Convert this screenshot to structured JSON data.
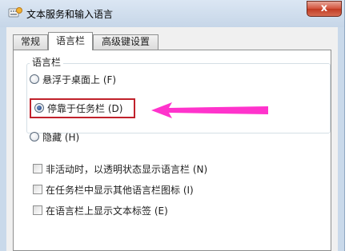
{
  "window": {
    "title": "文本服务和输入语言",
    "close_symbol": "x"
  },
  "tabs": [
    {
      "label": "常规",
      "active": false
    },
    {
      "label": "语言栏",
      "active": true
    },
    {
      "label": "高级键设置",
      "active": false
    }
  ],
  "language_bar_group": {
    "title": "语言栏",
    "options": [
      {
        "label": "悬浮于桌面上 (F)",
        "checked": false
      },
      {
        "label": "停靠于任务栏 (D)",
        "checked": true
      },
      {
        "label": "隐藏 (H)",
        "checked": false
      }
    ]
  },
  "checkboxes": [
    {
      "label": "非活动时，以透明状态显示语言栏 (N)",
      "checked": false
    },
    {
      "label": "在任务栏中显示其他语言栏图标 (I)",
      "checked": false
    },
    {
      "label": "在语言栏上显示文本标签 (E)",
      "checked": false
    }
  ],
  "colors": {
    "highlight_border": "#c0212b",
    "arrow": "#ff33cc"
  },
  "icons": {
    "title_icon": "keyboard-icon",
    "close_icon": "close-icon",
    "annotation_arrow": "arrow-left-icon"
  }
}
